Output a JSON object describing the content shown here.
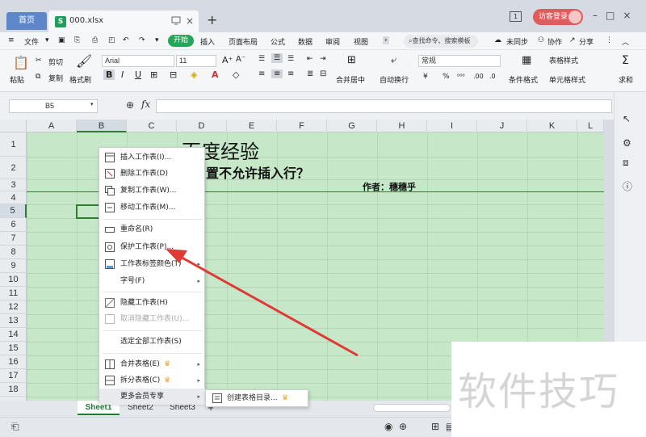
{
  "tabs": {
    "home": "首页",
    "file": "000.xlsx"
  },
  "titlebar": {
    "login": "访客登录",
    "badge": "1"
  },
  "menu": {
    "file": "文件",
    "items": [
      "开始",
      "插入",
      "页面布局",
      "公式",
      "数据",
      "审阅",
      "视图"
    ],
    "search": "查找命令、搜索模板",
    "right": [
      "未同步",
      "协作",
      "分享"
    ]
  },
  "ribbon": {
    "paste": "粘贴",
    "cut": "剪切",
    "copy": "复制",
    "format_painter": "格式刷",
    "font": "Arial",
    "size": "11",
    "merge": "合并居中",
    "wrap": "自动换行",
    "number_format": "常规",
    "cond_format": "条件格式",
    "table_style": "表格样式",
    "cell_style": "单元格样式",
    "sum": "求和",
    "percent": "%"
  },
  "formula": {
    "cell_ref": "B5",
    "fx": "fx"
  },
  "grid": {
    "columns": [
      "A",
      "B",
      "C",
      "D",
      "E",
      "F",
      "G",
      "H",
      "I",
      "J",
      "K",
      "L"
    ],
    "rows": [
      "1",
      "2",
      "3",
      "4",
      "5",
      "6",
      "7",
      "8",
      "9",
      "10",
      "11",
      "12",
      "13",
      "14",
      "15",
      "16",
      "17",
      "18"
    ]
  },
  "cells": {
    "title": "百度经验",
    "subtitle": "置不允许插入行？",
    "author": "作者：穗穗乎"
  },
  "context_menu": {
    "insert": "插入工作表(I)...",
    "delete": "删除工作表(D)",
    "copy": "复制工作表(W)...",
    "move": "移动工作表(M)...",
    "rename": "重命名(R)",
    "protect": "保护工作表(P)...",
    "tab_color": "工作表标签颜色(T)",
    "font_size": "字号(F)",
    "hide": "隐藏工作表(H)",
    "unhide": "取消隐藏工作表(U)...",
    "select_all": "选定全部工作表(S)",
    "merge": "合并表格(E)",
    "split": "拆分表格(C)",
    "member": "更多会员专享"
  },
  "submenu": {
    "create_dir": "创建表格目录..."
  },
  "sheets": [
    "Sheet1",
    "Sheet2",
    "Sheet3"
  ],
  "watermark": "软件技巧",
  "colors": {
    "sheet_bg": "#c6e7c8",
    "accent_green": "#26a65b",
    "arrow": "#e03a36",
    "login": "#e05b5b"
  }
}
